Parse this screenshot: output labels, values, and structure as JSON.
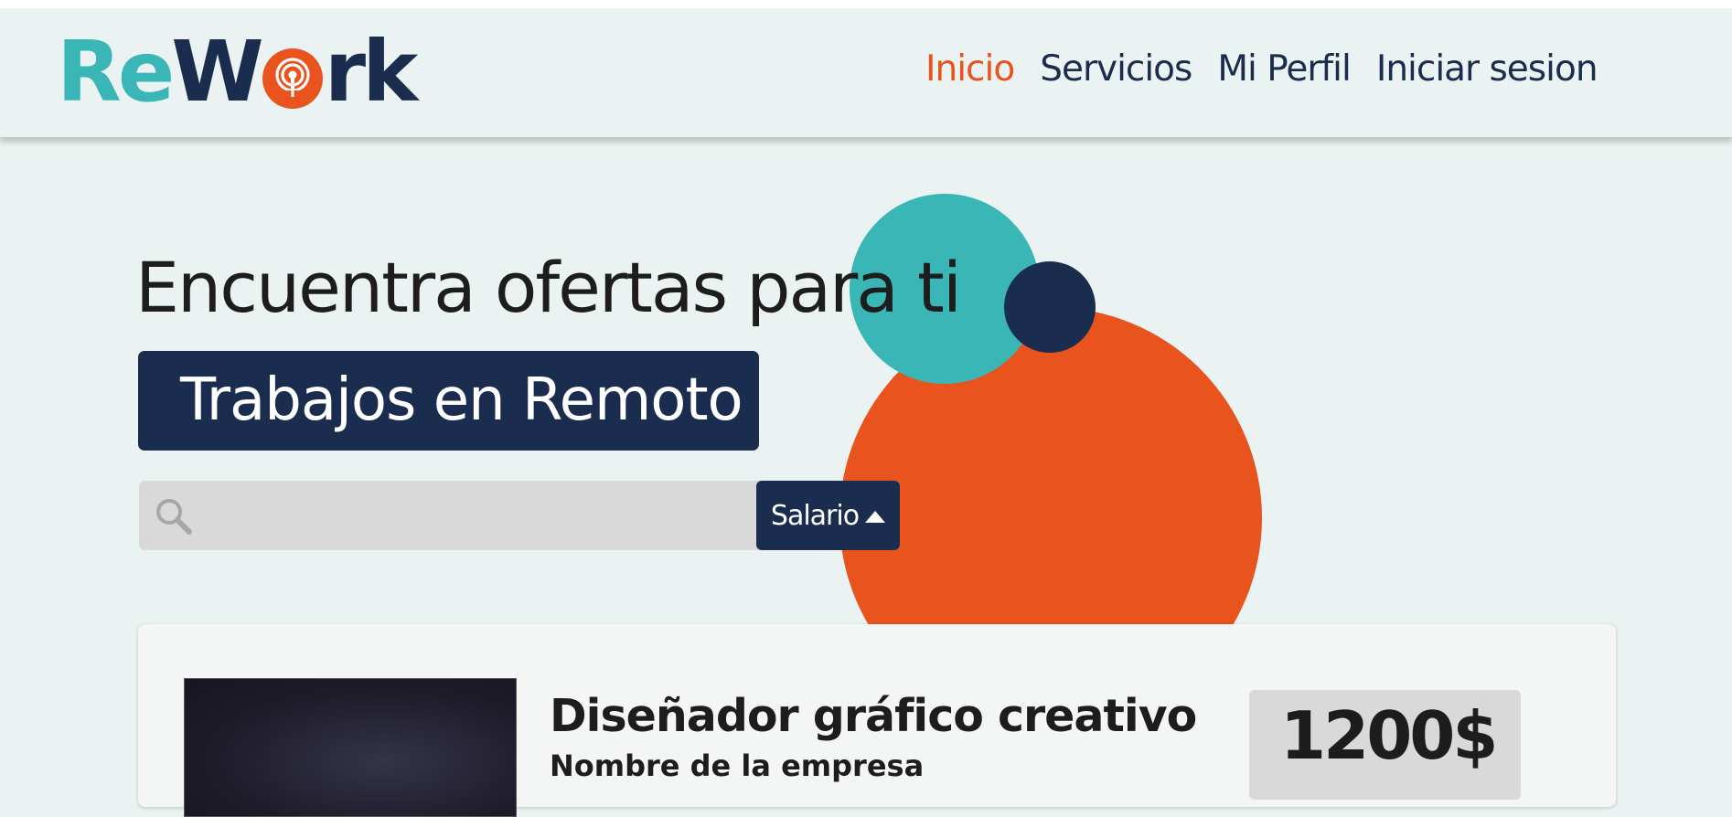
{
  "brand": {
    "logo_part1": "Re",
    "logo_part2": "W",
    "logo_part3": "rk",
    "colors": {
      "teal": "#3bb6b6",
      "navy": "#1b2d4f",
      "orange": "#e8531e"
    }
  },
  "nav": {
    "items": [
      {
        "label": "Inicio",
        "active": true
      },
      {
        "label": "Servicios",
        "active": false
      },
      {
        "label": "Mi Perfil",
        "active": false
      },
      {
        "label": "Iniciar sesion",
        "active": false
      }
    ]
  },
  "hero": {
    "title": "Encuentra ofertas para ti",
    "badge": "Trabajos en Remoto"
  },
  "search": {
    "placeholder": "",
    "value": "",
    "filter_label": "Salario",
    "icon": "search-icon",
    "filter_icon": "caret-up-icon"
  },
  "jobs": [
    {
      "title": "Diseñador gráfico creativo",
      "company": "Nombre de la empresa",
      "salary": "1200$"
    }
  ]
}
